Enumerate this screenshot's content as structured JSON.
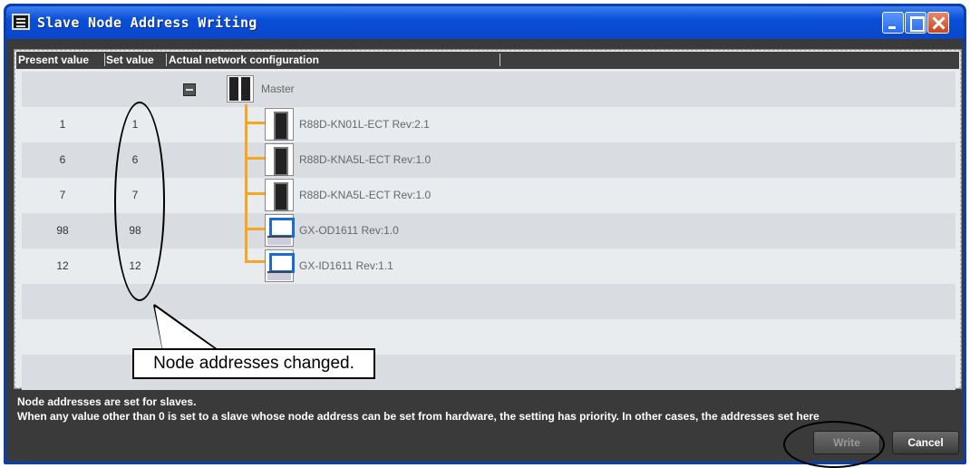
{
  "window": {
    "title": "Slave Node Address Writing",
    "controls": [
      "minimize-icon",
      "maximize-icon",
      "close-icon"
    ]
  },
  "grid": {
    "headers": {
      "present": "Present value",
      "set": "Set value",
      "config": "Actual network configuration"
    },
    "master": {
      "name": "Master"
    },
    "slaves": [
      {
        "present": "1",
        "set": "1",
        "name": "R88D-KN01L-ECT Rev:2.1",
        "icon": "servo-drive-icon"
      },
      {
        "present": "6",
        "set": "6",
        "name": "R88D-KNA5L-ECT Rev:1.0",
        "icon": "servo-drive-icon"
      },
      {
        "present": "7",
        "set": "7",
        "name": "R88D-KNA5L-ECT Rev:1.0",
        "icon": "servo-drive-icon"
      },
      {
        "present": "98",
        "set": "98",
        "name": "GX-OD1611 Rev:1.0",
        "icon": "io-unit-icon"
      },
      {
        "present": "12",
        "set": "12",
        "name": "GX-ID1611 Rev:1.1",
        "icon": "io-unit-icon"
      }
    ]
  },
  "status": {
    "line1": "Node addresses are set for slaves.",
    "line2": "When any value other than 0 is set to a slave whose node address can be set from hardware, the setting has priority. In other cases, the addresses set here"
  },
  "buttons": {
    "write": "Write",
    "cancel": "Cancel"
  },
  "annotation": {
    "callout": "Node addresses changed."
  },
  "colors": {
    "titlebar": "#0a4fd8",
    "body": "#3a3a3a",
    "connector": "#f5a623"
  }
}
